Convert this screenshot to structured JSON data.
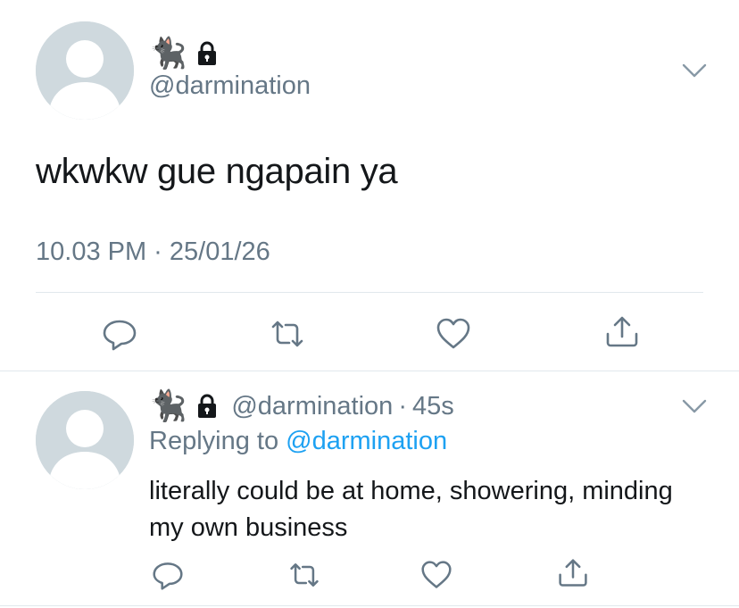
{
  "main_tweet": {
    "display_name_emoji": "🐈‍⬛",
    "handle": "@darmination",
    "text": "wkwkw gue ngapain ya",
    "timestamp": "10.03 PM · 25/01/26"
  },
  "reply_tweet": {
    "display_name_emoji": "🐈‍⬛",
    "handle": "@darmination",
    "separator": "·",
    "age": "45s",
    "replying_to_label": "Replying to",
    "replying_to_handle": "@darmination",
    "text": "literally could be at home, showering, minding my own business"
  },
  "actions": [
    "reply-icon",
    "retweet-icon",
    "like-icon",
    "share-icon"
  ],
  "colors": {
    "text": "#14171a",
    "secondary": "#657786",
    "link": "#1da1f2",
    "divider": "#e1e8ed",
    "avatar_bg": "#cfd9de",
    "avatar_fg": "#ffffff"
  }
}
